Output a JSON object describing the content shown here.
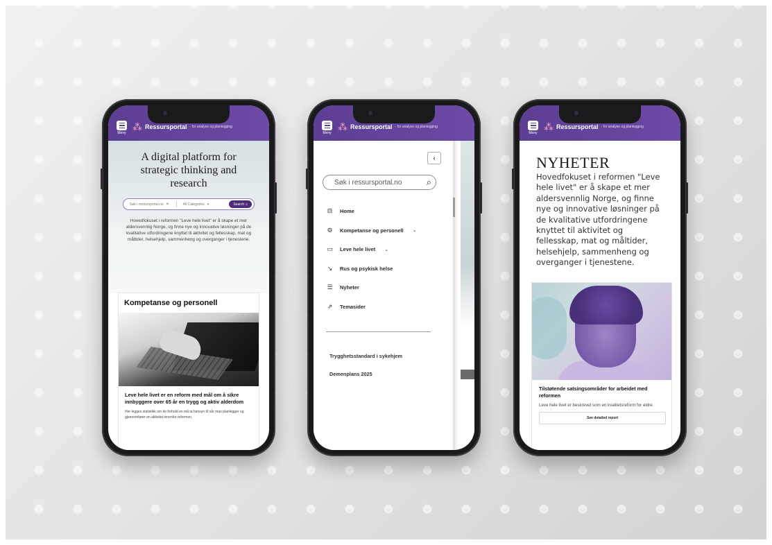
{
  "brand": {
    "menu_label": "Meny",
    "name": "Ressursportal",
    "tagline": "- for analyse og planlegging"
  },
  "home": {
    "hero_title": "A digital platform for strategic thinking and research",
    "search_placeholder": "Søk i ressursportal.no",
    "category_label": "All Categories",
    "search_button": "Search",
    "hero_body": "Hovedfokuset i reformen \"Leve hele livet\" er å skape et mer aldersvennlig Norge, og finne nye og innovative løsninger på de kvalitative utfordringene knyttet til aktivitet og fellesskap, mat og måltider, helsehjelp, sammenheng og overganger i tjenestene.",
    "card": {
      "title": "Kompetanse og personell",
      "headline": "Leve hele livet er en reform med mål om å sikre innbyggere over 65 år en trygg og aktiv alderdom",
      "description": "Her legges statistikk om de forhold en må ta hensyn til når man planlegger og gjennomfører en aktivitet innenfor reformen."
    }
  },
  "menu": {
    "close_glyph": "‹",
    "search_placeholder": "Søk i ressursportal.no",
    "items": [
      {
        "label": "Home",
        "icon": "inbox-icon",
        "glyph": "⊟"
      },
      {
        "label": "Kompetanse og personell",
        "icon": "gear-icon",
        "glyph": "⚙",
        "chevron": "⌄"
      },
      {
        "label": "Leve hele livet",
        "icon": "card-icon",
        "glyph": "▭",
        "chevron": "⌄"
      },
      {
        "label": "Rus og psykisk helse",
        "icon": "trend-down-icon",
        "glyph": "↘"
      },
      {
        "label": "Nyheter",
        "icon": "document-icon",
        "glyph": "☰"
      },
      {
        "label": "Temasider",
        "icon": "trend-up-icon",
        "glyph": "⇗"
      }
    ],
    "sub_links": [
      "Trygghetsstandard i sykehjem",
      "Demenplans 2025"
    ]
  },
  "news": {
    "title": "NYHETER",
    "body": "Hovedfokuset i reformen \"Leve hele livet\" er å skape et mer aldersvennlig Norge, og finne nye og innovative løsninger på de kvalitative utfordringene knyttet til aktivitet og fellesskap, mat og måltider, helsehjelp, sammenheng og overganger i tjenestene.",
    "card": {
      "headline": "Tilstøtende satsingsområder for arbeidet med reformen",
      "description": "Leve hele livet er beskrevet som en kvalitetsreform for eldre.",
      "button": "See detailed report"
    }
  },
  "colors": {
    "header_purple": "#5c3e93",
    "search_button": "#4d2a7a",
    "logo_pink": "#f4a7c6"
  }
}
